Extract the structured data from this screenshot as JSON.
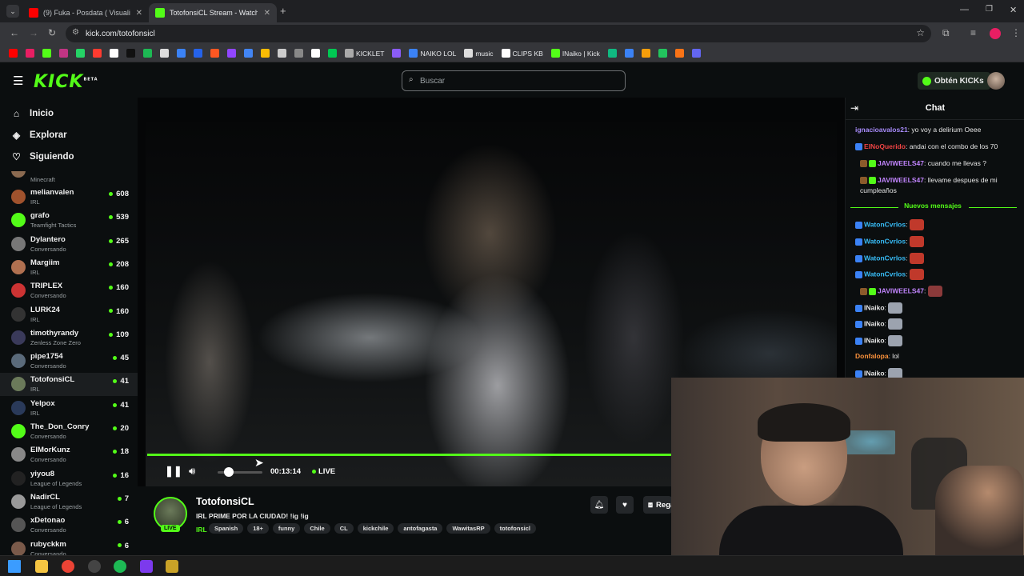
{
  "browser": {
    "tabs": [
      {
        "title": "(9) Fuka - Posdata ( Visuali",
        "active": false,
        "favicon_color": "#ff0000"
      },
      {
        "title": "TotofonsiCL Stream - Watch",
        "active": true,
        "favicon_color": "#53fc18"
      }
    ],
    "new_tab_label": "+",
    "url": "kick.com/totofonsicl",
    "bookmarks": [
      {
        "label": "",
        "color": "#ff0000"
      },
      {
        "label": "",
        "color": "#e91e63"
      },
      {
        "label": "",
        "color": "#53fc18"
      },
      {
        "label": "",
        "color": "#c13584"
      },
      {
        "label": "",
        "color": "#25d366"
      },
      {
        "label": "",
        "color": "#ff3b30"
      },
      {
        "label": "",
        "color": "#ffffff"
      },
      {
        "label": "",
        "color": "#111111"
      },
      {
        "label": "",
        "color": "#1db954"
      },
      {
        "label": "",
        "color": "#dddddd"
      },
      {
        "label": "",
        "color": "#3b82f6"
      },
      {
        "label": "",
        "color": "#2563eb"
      },
      {
        "label": "",
        "color": "#ff5722"
      },
      {
        "label": "",
        "color": "#9146ff"
      },
      {
        "label": "",
        "color": "#4285f4"
      },
      {
        "label": "",
        "color": "#fbbc04"
      },
      {
        "label": "",
        "color": "#cccccc"
      },
      {
        "label": "",
        "color": "#888888"
      },
      {
        "label": "",
        "color": "#ffffff"
      },
      {
        "label": "",
        "color": "#00c853"
      },
      {
        "label": "KICKLET",
        "color": "#aaaaaa"
      },
      {
        "label": "",
        "color": "#8b5cf6"
      },
      {
        "label": "NAIKO LOL",
        "color": "#3b82f6"
      },
      {
        "label": "music",
        "color": "#dddddd"
      },
      {
        "label": "CLIPS KB",
        "color": "#ffffff"
      },
      {
        "label": "INaiko | Kick",
        "color": "#53fc18"
      },
      {
        "label": "",
        "color": "#10b981"
      },
      {
        "label": "",
        "color": "#3b82f6"
      },
      {
        "label": "",
        "color": "#f59e0b"
      },
      {
        "label": "",
        "color": "#22c55e"
      },
      {
        "label": "",
        "color": "#f97316"
      },
      {
        "label": "",
        "color": "#6366f1"
      }
    ]
  },
  "kick": {
    "logo": "KICK",
    "logo_sup": "BETA",
    "search_placeholder": "Buscar",
    "get_kicks": "Obtén KICKs"
  },
  "sidebar": {
    "nav": [
      {
        "label": "Inicio",
        "icon": "home-icon"
      },
      {
        "label": "Explorar",
        "icon": "compass-icon"
      },
      {
        "label": "Siguiendo",
        "icon": "heart-icon"
      }
    ],
    "partial_category": "Minecraft",
    "channels": [
      {
        "name": "melianvalen",
        "category": "IRL",
        "viewers": "608",
        "color": "#a0522d"
      },
      {
        "name": "grafo",
        "category": "Teamfight Tactics",
        "viewers": "539",
        "color": "#53fc18"
      },
      {
        "name": "Dylantero",
        "category": "Conversando",
        "viewers": "265",
        "color": "#777777"
      },
      {
        "name": "Margiim",
        "category": "IRL",
        "viewers": "208",
        "color": "#b07050"
      },
      {
        "name": "TRIPLEX",
        "category": "Conversando",
        "viewers": "160",
        "color": "#cc3333"
      },
      {
        "name": "LURK24",
        "category": "IRL",
        "viewers": "160",
        "color": "#333333"
      },
      {
        "name": "timothyrandy",
        "category": "Zenless Zone Zero",
        "viewers": "109",
        "color": "#3a3a5a"
      },
      {
        "name": "pipe1754",
        "category": "Conversando",
        "viewers": "45",
        "color": "#5a6a7a"
      },
      {
        "name": "TotofonsiCL",
        "category": "IRL",
        "viewers": "41",
        "color": "#6b7a5a",
        "selected": true
      },
      {
        "name": "Yelpox",
        "category": "IRL",
        "viewers": "41",
        "color": "#2a3a5a"
      },
      {
        "name": "The_Don_Conry",
        "category": "Conversando",
        "viewers": "20",
        "color": "#53fc18"
      },
      {
        "name": "ElMorKunz",
        "category": "Conversando",
        "viewers": "18",
        "color": "#888888"
      },
      {
        "name": "yiyou8",
        "category": "League of Legends",
        "viewers": "16",
        "color": "#222222"
      },
      {
        "name": "NadirCL",
        "category": "League of Legends",
        "viewers": "7",
        "color": "#999999"
      },
      {
        "name": "xDetonao",
        "category": "Conversando",
        "viewers": "6",
        "color": "#555555"
      },
      {
        "name": "rubyckkm",
        "category": "Conversando",
        "viewers": "6",
        "color": "#7a5a4a"
      }
    ]
  },
  "player": {
    "progress": 1.0,
    "volume": 0.25,
    "time": "00:13:14",
    "live_label": "LIVE"
  },
  "stream": {
    "name": "TotofonsiCL",
    "title": "IRL PRIME POR LA CIUDAD! !ig !ig",
    "live_badge": "LIVE",
    "category": "IRL",
    "tags": [
      "Spanish",
      "18+",
      "funny",
      "Chile",
      "CL",
      "kickchile",
      "antofagasta",
      "WawitasRP",
      "totofonsicl"
    ],
    "subscribe_label": "Regalar"
  },
  "chat": {
    "title": "Chat",
    "new_messages_label": "Nuevos mensajes",
    "messages": [
      {
        "user": "ignacioavalos21",
        "user_color": "#a78bfa",
        "text": " yo voy a delirium Oeee",
        "badges": []
      },
      {
        "user": "ElNoQuerido",
        "user_color": "#ef4444",
        "text": " andai con el combo de los 70",
        "badges": [
          "#3b82f6"
        ]
      },
      {
        "user": "JAVIWEELS47",
        "user_color": "#c084fc",
        "text": " cuando me llevas ?",
        "badges": [
          "#8b5a2b",
          "#53fc18"
        ]
      },
      {
        "user": "JAVIWEELS47",
        "user_color": "#c084fc",
        "text": " llevame despues de mi cumpleaños",
        "badges": [
          "#8b5a2b",
          "#53fc18"
        ]
      },
      {
        "user": "WatonCvrlos",
        "user_color": "#38bdf8",
        "text": "",
        "badges": [
          "#3b82f6"
        ],
        "emote": "#c0392b"
      },
      {
        "user": "WatonCvrlos",
        "user_color": "#38bdf8",
        "text": "",
        "badges": [
          "#3b82f6"
        ],
        "emote": "#c0392b"
      },
      {
        "user": "WatonCvrlos",
        "user_color": "#38bdf8",
        "text": "",
        "badges": [
          "#3b82f6"
        ],
        "emote": "#c0392b"
      },
      {
        "user": "WatonCvrlos",
        "user_color": "#38bdf8",
        "text": "",
        "badges": [
          "#3b82f6"
        ],
        "emote": "#c0392b"
      },
      {
        "user": "JAVIWEELS47",
        "user_color": "#c084fc",
        "text": "",
        "badges": [
          "#8b5a2b",
          "#53fc18"
        ],
        "emote": "#8b3a3a"
      },
      {
        "user": "INaiko",
        "user_color": "#e6e6e6",
        "text": "",
        "badges": [
          "#3b82f6"
        ],
        "emote": "#9ca3af"
      },
      {
        "user": "INaiko",
        "user_color": "#e6e6e6",
        "text": "",
        "badges": [
          "#3b82f6"
        ],
        "emote": "#9ca3af"
      },
      {
        "user": "INaiko",
        "user_color": "#e6e6e6",
        "text": "",
        "badges": [
          "#3b82f6"
        ],
        "emote": "#9ca3af"
      },
      {
        "user": "Donfalopa",
        "user_color": "#fb923c",
        "text": " lol",
        "badges": []
      },
      {
        "user": "INaiko",
        "user_color": "#e6e6e6",
        "text": "",
        "badges": [
          "#3b82f6"
        ],
        "emote": "#9ca3af"
      }
    ]
  },
  "taskbar": {
    "icons": [
      {
        "name": "windows-start-icon",
        "color": "#3b9cff"
      },
      {
        "name": "file-explorer-icon",
        "color": "#f5c542"
      },
      {
        "name": "chrome-icon",
        "color": "#ea4335"
      },
      {
        "name": "obs-icon",
        "color": "#444444"
      },
      {
        "name": "spotify-icon",
        "color": "#1db954"
      },
      {
        "name": "app-icon",
        "color": "#7c3aed"
      },
      {
        "name": "app-icon-2",
        "color": "#c9a227"
      }
    ]
  },
  "colors": {
    "accent": "#53fc18",
    "background": "#0b0e0f"
  }
}
